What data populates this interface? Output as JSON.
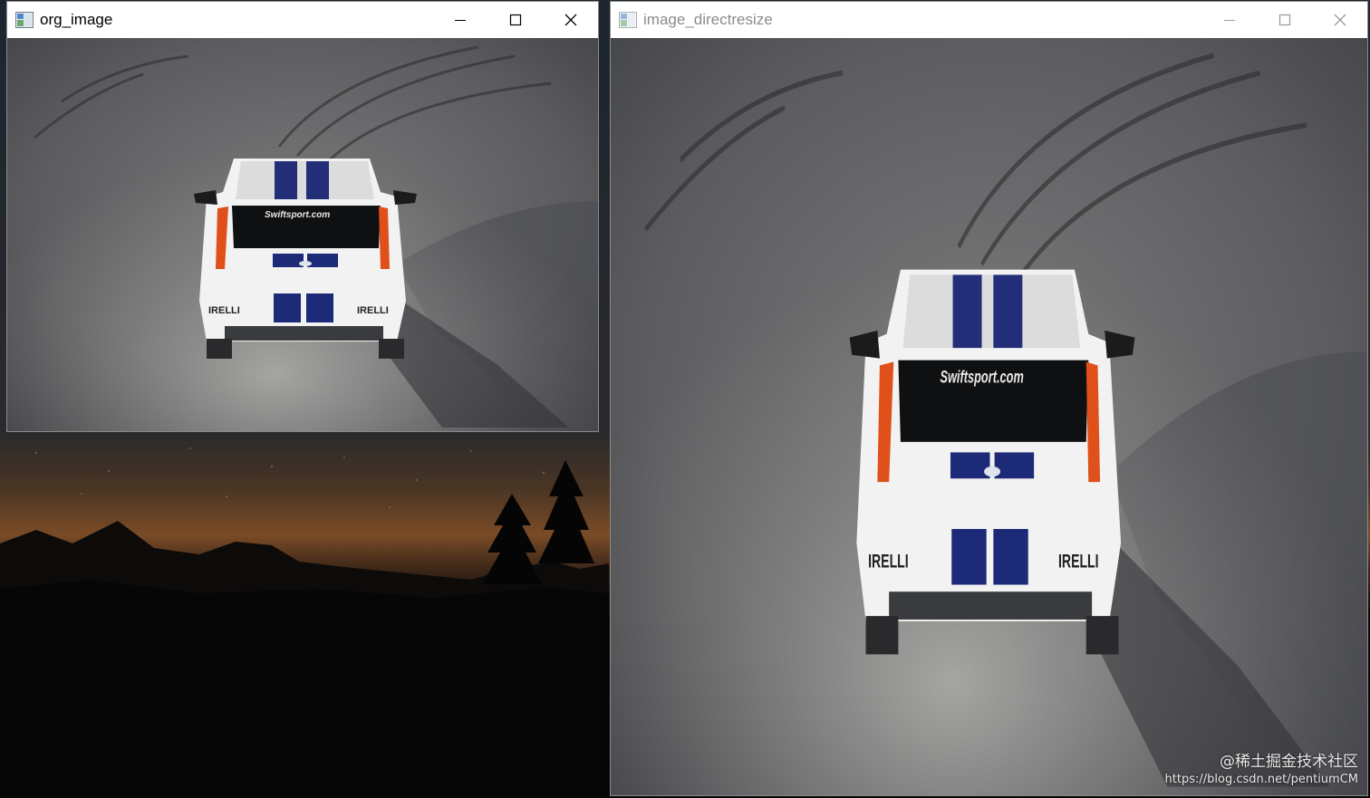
{
  "windows": {
    "original": {
      "title": "org_image",
      "icon": "app-window-icon",
      "state": "active",
      "image": {
        "subject": "rally-car-photo",
        "sticker_text": "Swiftsport.com",
        "sponsor_text": "IRELLI"
      }
    },
    "resized": {
      "title": "image_directresize",
      "icon": "app-window-icon",
      "state": "inactive",
      "image": {
        "subject": "rally-car-photo-resized",
        "sticker_text": "Swiftsport.com",
        "sponsor_text": "IRELLI"
      }
    }
  },
  "controls": {
    "minimize": "minimize-icon",
    "maximize": "maximize-icon",
    "close": "close-icon"
  },
  "watermark": {
    "line1": "@稀土掘金技术社区",
    "line2": "https://blog.csdn.net/pentiumCM"
  },
  "colors": {
    "road": "#6a6a6c",
    "car_body": "#f4f4f4",
    "stripe": "#1c2a78",
    "taillight": "#e0501a",
    "title_inactive": "#8c8c8c"
  }
}
